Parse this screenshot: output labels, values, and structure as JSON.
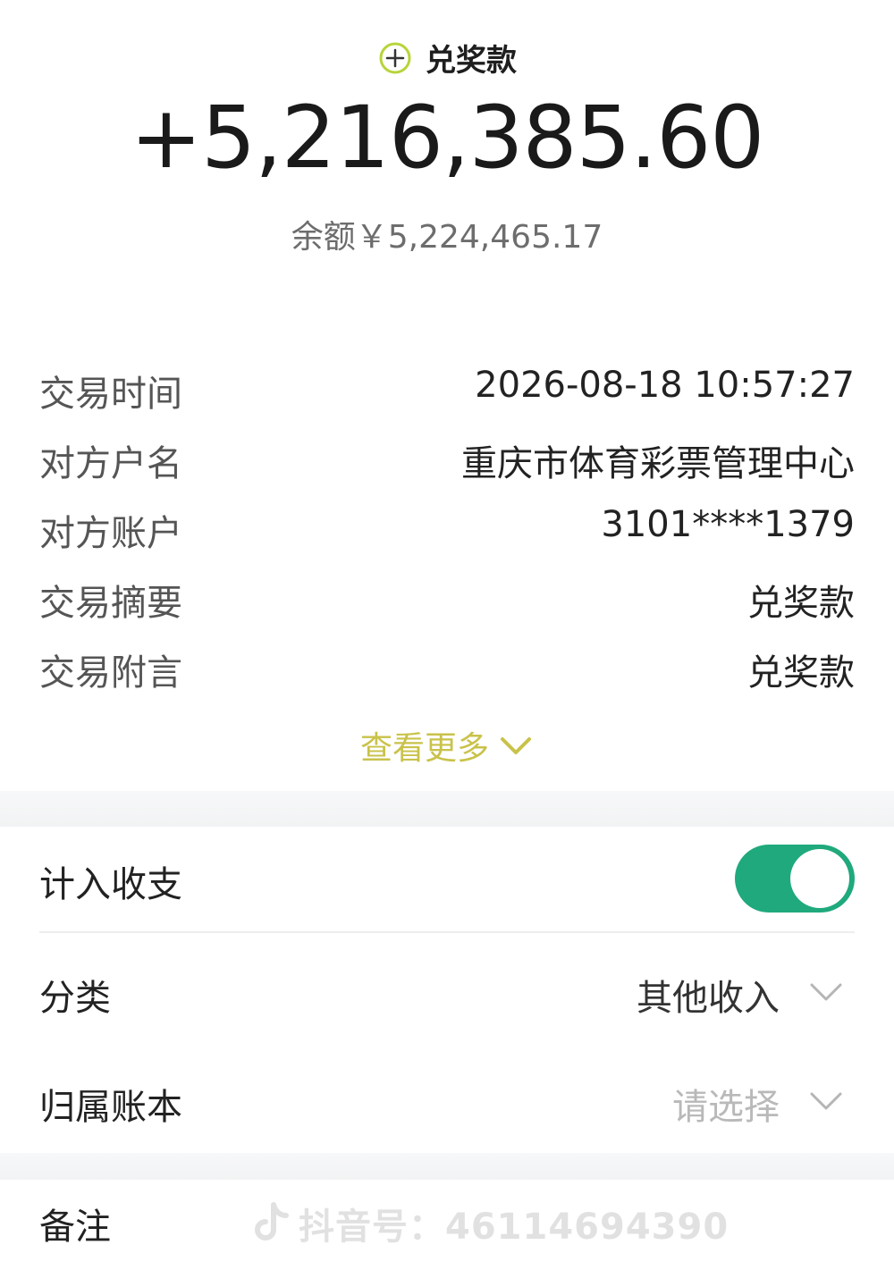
{
  "header": {
    "icon": "plus-circle-icon",
    "title": "兑奖款",
    "amount": "+5,216,385.60",
    "balance": "余额￥5,224,465.17"
  },
  "details": [
    {
      "label": "交易时间",
      "value": "2026-08-18 10:57:27"
    },
    {
      "label": "对方户名",
      "value": "重庆市体育彩票管理中心"
    },
    {
      "label": "对方账户",
      "value": "3101****1379"
    },
    {
      "label": "交易摘要",
      "value": "兑奖款"
    },
    {
      "label": "交易附言",
      "value": "兑奖款"
    }
  ],
  "more": {
    "label": "查看更多",
    "icon": "chevron-down-icon"
  },
  "settings": {
    "include": {
      "label": "计入收支",
      "toggle_on": true
    },
    "category": {
      "label": "分类",
      "value": "其他收入"
    },
    "ledger": {
      "label": "归属账本",
      "placeholder": "请选择"
    },
    "note": {
      "label": "备注"
    }
  },
  "watermark": {
    "text": "抖音号：46114694390"
  },
  "colors": {
    "accent": "#1fa97c",
    "more_link": "#c9c24a",
    "icon_ring": "#b7d43a"
  }
}
